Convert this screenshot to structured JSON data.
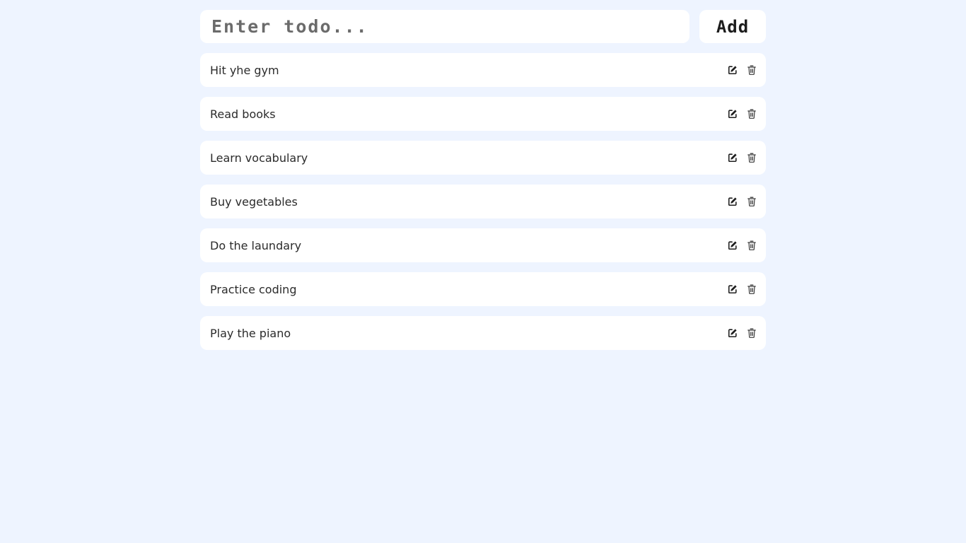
{
  "form": {
    "input_placeholder": "Enter todo...",
    "input_value": "",
    "add_label": "Add"
  },
  "todos": [
    {
      "text": "Hit yhe gym"
    },
    {
      "text": "Read books"
    },
    {
      "text": "Learn vocabulary"
    },
    {
      "text": "Buy vegetables"
    },
    {
      "text": "Do the laundary"
    },
    {
      "text": "Practice coding"
    },
    {
      "text": "Play the piano"
    }
  ],
  "icons": {
    "edit": "edit-icon",
    "delete": "trash-icon"
  },
  "colors": {
    "background": "#eef4ff",
    "card": "#ffffff",
    "text": "#2b2b2b",
    "placeholder": "#6b6b6b"
  }
}
